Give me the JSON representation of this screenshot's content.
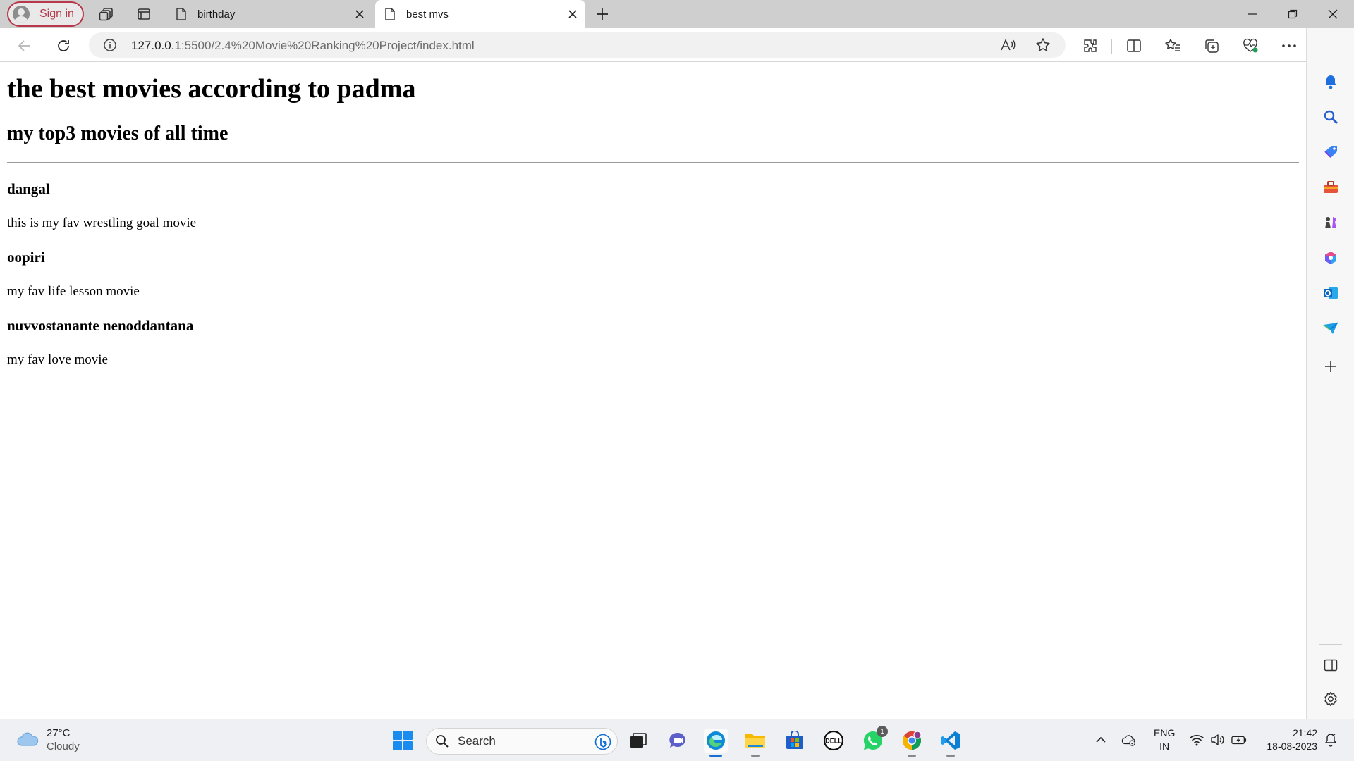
{
  "browser": {
    "signin_label": "Sign in",
    "tabs": [
      {
        "title": "birthday",
        "active": false
      },
      {
        "title": "best mvs",
        "active": true
      }
    ],
    "address": {
      "host": "127.0.0.1",
      "path": ":5500/2.4%20Movie%20Ranking%20Project/index.html"
    }
  },
  "page": {
    "heading": "the best movies according to padma",
    "subheading": "my top3 movies of all time",
    "movies": [
      {
        "title": "dangal",
        "description": "this is my fav wrestling goal movie"
      },
      {
        "title": "oopiri",
        "description": "my fav life lesson movie"
      },
      {
        "title": "nuvvostanante nenoddantana",
        "description": "my fav love movie"
      }
    ]
  },
  "taskbar": {
    "weather": {
      "temp": "27°C",
      "condition": "Cloudy"
    },
    "search_label": "Search",
    "whatsapp_badge": "1",
    "language": {
      "line1": "ENG",
      "line2": "IN"
    },
    "clock": {
      "time": "21:42",
      "date": "18-08-2023"
    }
  },
  "colors": {
    "accent": "#b8374a",
    "edge_blue": "#0c6ed6",
    "tab_strip": "#cfcfcf"
  }
}
